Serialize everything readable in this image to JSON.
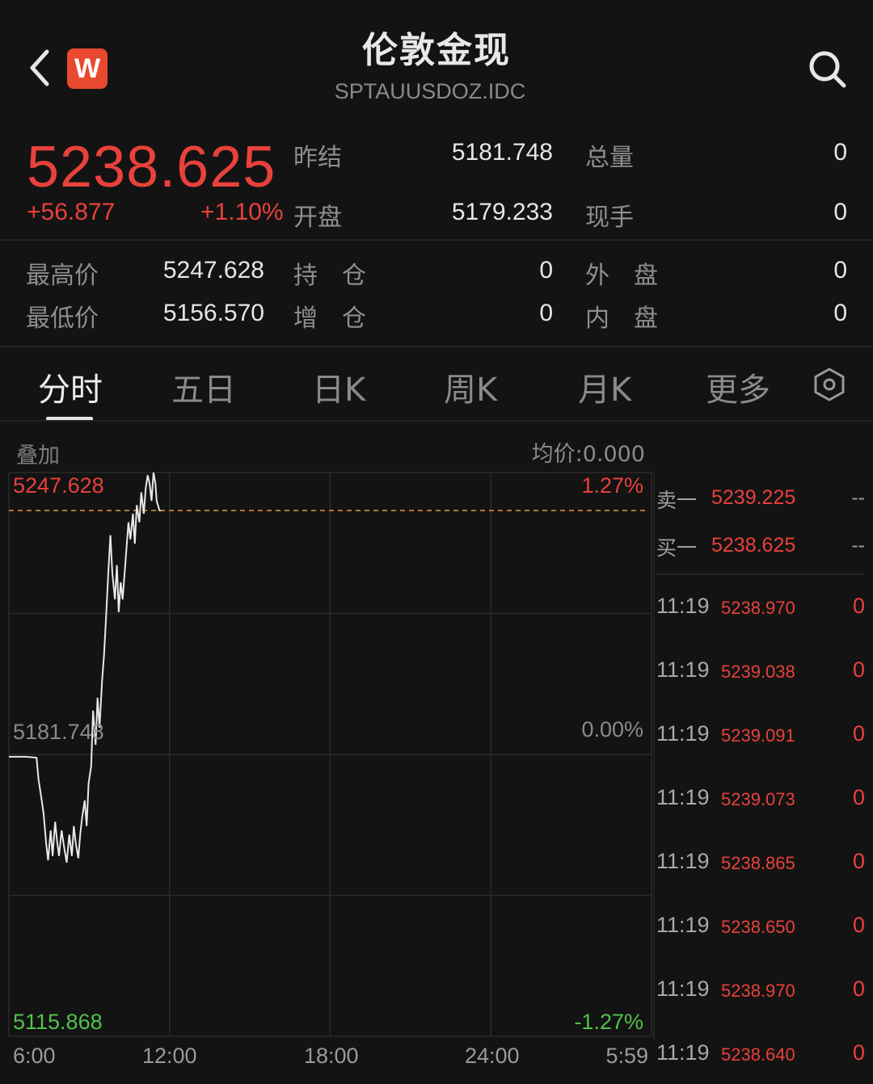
{
  "header": {
    "title": "伦敦金现",
    "code": "SPTAUUSDOZ.IDC",
    "logo_text": "W",
    "icons": [
      "back-arrow-icon",
      "app-logo-icon",
      "search-icon"
    ]
  },
  "quote": {
    "price": "5238.625",
    "change": "+56.877",
    "change_pct": "+1.10%",
    "prev_settle_label": "昨结",
    "prev_settle": "5181.748",
    "open_label": "开盘",
    "open": "5179.233",
    "total_vol_label": "总量",
    "total_vol": "0",
    "current_hand_label": "现手",
    "current_hand": "0",
    "high_label": "最高价",
    "high": "5247.628",
    "low_label": "最低价",
    "low": "5156.570",
    "open_interest_label": "持　仓",
    "open_interest": "0",
    "oi_change_label": "增　仓",
    "oi_change": "0",
    "outer_label": "外　盘",
    "outer": "0",
    "inner_label": "内　盘",
    "inner": "0",
    "accent_up": "#e8413b",
    "accent_down": "#52c24a"
  },
  "tabs": [
    {
      "label": "分时",
      "active": true
    },
    {
      "label": "五日",
      "active": false
    },
    {
      "label": "日K",
      "active": false
    },
    {
      "label": "周K",
      "active": false
    },
    {
      "label": "月K",
      "active": false
    },
    {
      "label": "更多",
      "active": false
    }
  ],
  "chart": {
    "overlay_label": "叠加",
    "avg_price_label": "均价:0.000",
    "y_top": "5247.628",
    "y_mid": "5181.748",
    "y_bottom": "5115.868",
    "pct_top": "1.27%",
    "pct_mid": "0.00%",
    "pct_bottom": "-1.27%",
    "x_labels": [
      "6:00",
      "12:00",
      "18:00",
      "24:00",
      "5:59"
    ]
  },
  "chart_data": {
    "type": "line",
    "title": "",
    "xlabel": "",
    "ylabel": "",
    "ylim": [
      5115.868,
      5247.628
    ],
    "reference_line": 5181.748,
    "high_line": 5247.628,
    "x_ticks": [
      "6:00",
      "12:00",
      "18:00",
      "24:00",
      "5:59"
    ],
    "series": [
      {
        "name": "",
        "x_fraction": [
          0.0,
          0.016,
          0.026,
          0.043,
          0.046,
          0.05,
          0.054,
          0.058,
          0.061,
          0.065,
          0.068,
          0.072,
          0.075,
          0.078,
          0.082,
          0.086,
          0.09,
          0.094,
          0.098,
          0.101,
          0.104,
          0.108,
          0.111,
          0.114,
          0.118,
          0.121,
          0.124,
          0.128,
          0.131,
          0.135,
          0.138,
          0.141,
          0.145,
          0.148,
          0.151,
          0.155,
          0.158,
          0.161,
          0.165,
          0.168,
          0.171,
          0.174,
          0.177,
          0.18,
          0.183,
          0.186,
          0.189,
          0.193,
          0.196,
          0.199,
          0.203,
          0.206,
          0.21,
          0.213,
          0.216,
          0.219,
          0.222,
          0.225,
          0.228,
          0.23,
          0.232,
          0.234,
          0.236
        ],
        "values": [
          5181.2,
          5181.2,
          5181.2,
          5181.0,
          5176.0,
          5172.0,
          5168.0,
          5161.0,
          5157.0,
          5164.0,
          5158.0,
          5166.0,
          5161.5,
          5158.0,
          5164.0,
          5160.0,
          5156.5,
          5163.0,
          5158.0,
          5165.0,
          5161.0,
          5157.5,
          5163.0,
          5167.0,
          5171.0,
          5165.0,
          5175.0,
          5179.0,
          5192.0,
          5184.0,
          5195.0,
          5188.0,
          5199.0,
          5205.0,
          5213.0,
          5225.0,
          5233.0,
          5224.0,
          5218.0,
          5226.0,
          5215.0,
          5222.0,
          5218.0,
          5224.0,
          5230.0,
          5236.0,
          5232.0,
          5238.0,
          5231.0,
          5240.0,
          5236.0,
          5243.0,
          5238.0,
          5244.0,
          5247.0,
          5245.0,
          5241.0,
          5247.6,
          5245.0,
          5241.0,
          5240.0,
          5238.9,
          5238.6
        ]
      }
    ],
    "legend": "none",
    "grid": true
  },
  "order_book": {
    "sell_label": "卖一",
    "sell_price": "5239.225",
    "sell_vol": "--",
    "buy_label": "买一",
    "buy_price": "5238.625",
    "buy_vol": "--"
  },
  "ticks": [
    {
      "time": "11:19",
      "price": "5238.970",
      "vol": "0"
    },
    {
      "time": "11:19",
      "price": "5239.038",
      "vol": "0"
    },
    {
      "time": "11:19",
      "price": "5239.091",
      "vol": "0"
    },
    {
      "time": "11:19",
      "price": "5239.073",
      "vol": "0"
    },
    {
      "time": "11:19",
      "price": "5238.865",
      "vol": "0"
    },
    {
      "time": "11:19",
      "price": "5238.650",
      "vol": "0"
    },
    {
      "time": "11:19",
      "price": "5238.970",
      "vol": "0"
    },
    {
      "time": "11:19",
      "price": "5238.640",
      "vol": "0"
    }
  ]
}
